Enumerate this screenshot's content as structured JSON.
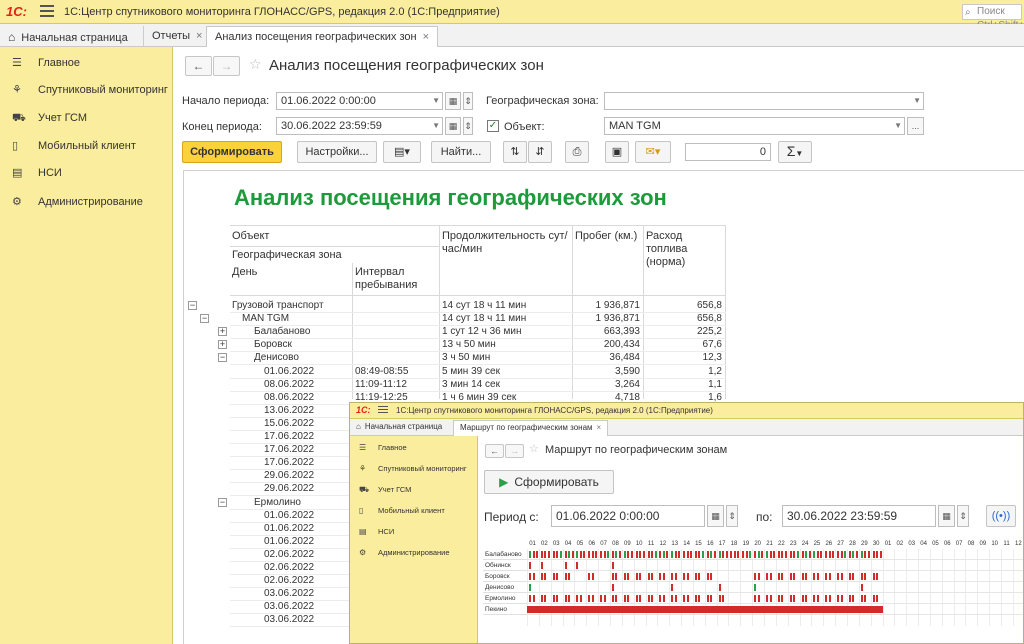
{
  "app": {
    "logo": "1С:",
    "title": "1С:Центр спутникового мониторинга ГЛОНАСС/GPS, редакция 2.0  (1С:Предприятие)",
    "search_placeholder": "Поиск Ctrl+Shift+F"
  },
  "tabs": [
    {
      "label": "Начальная страница",
      "icon": "home-icon"
    },
    {
      "label": "Отчеты"
    },
    {
      "label": "Анализ посещения географических зон",
      "active": true
    }
  ],
  "sidebar": {
    "items": [
      {
        "label": "Главное",
        "icon": "menu-lines-icon"
      },
      {
        "label": "Спутниковый мониторинг",
        "icon": "satellite-icon"
      },
      {
        "label": "Учет ГСМ",
        "icon": "truck-icon"
      },
      {
        "label": "Мобильный клиент",
        "icon": "phone-icon"
      },
      {
        "label": "НСИ",
        "icon": "books-icon"
      },
      {
        "label": "Администрирование",
        "icon": "gear-icon"
      }
    ]
  },
  "form": {
    "title": "Анализ посещения географических зон",
    "period_start_label": "Начало периода:",
    "period_start_value": "01.06.2022  0:00:00",
    "period_end_label": "Конец периода:",
    "period_end_value": "30.06.2022 23:59:59",
    "zone_label": "Географическая зона:",
    "zone_value": "",
    "object_label": "Объект:",
    "object_checked": true,
    "object_value": "MAN TGM",
    "object_more": "...",
    "buttons": {
      "generate": "Сформировать",
      "settings": "Настройки...",
      "find": "Найти...",
      "sum_value": "0",
      "sigma": "Σ"
    }
  },
  "report": {
    "title": "Анализ посещения географических зон",
    "headers": {
      "object": "Объект",
      "zone": "Географическая зона",
      "day": "День",
      "interval": "Интервал пребывания",
      "duration": "Продолжительность сут/час/мин",
      "mileage": "Пробег (км.)",
      "fuel": "Расход топлива (норма)"
    },
    "rows": [
      {
        "name": "Грузовой транспорт",
        "level": 0,
        "toggle": "−",
        "interval": "",
        "duration": "14 сут 18 ч 11 мин",
        "mileage": "1 936,871",
        "fuel": "656,8"
      },
      {
        "name": "MAN TGM",
        "level": 1,
        "toggle": "−",
        "interval": "",
        "duration": "14 сут 18 ч 11 мин",
        "mileage": "1 936,871",
        "fuel": "656,8"
      },
      {
        "name": "Балабаново",
        "level": 2,
        "toggle": "+",
        "interval": "",
        "duration": "1 сут 12 ч 36 мин",
        "mileage": "663,393",
        "fuel": "225,2"
      },
      {
        "name": "Боровск",
        "level": 2,
        "toggle": "+",
        "interval": "",
        "duration": "13 ч 50 мин",
        "mileage": "200,434",
        "fuel": "67,6"
      },
      {
        "name": "Денисово",
        "level": 2,
        "toggle": "−",
        "interval": "",
        "duration": "3 ч 50 мин",
        "mileage": "36,484",
        "fuel": "12,3"
      },
      {
        "name": "01.06.2022",
        "level": 3,
        "interval": "08:49-08:55",
        "duration": "5 мин 39 сек",
        "mileage": "3,590",
        "fuel": "1,2"
      },
      {
        "name": "08.06.2022",
        "level": 3,
        "interval": "11:09-11:12",
        "duration": "3 мин 14 сек",
        "mileage": "3,264",
        "fuel": "1,1"
      },
      {
        "name": "08.06.2022",
        "level": 3,
        "interval": "11:19-12:25",
        "duration": "1 ч 6 мин 39 сек",
        "mileage": "4,718",
        "fuel": "1,6"
      },
      {
        "name": "13.06.2022",
        "level": 3
      },
      {
        "name": "15.06.2022",
        "level": 3
      },
      {
        "name": "17.06.2022",
        "level": 3
      },
      {
        "name": "17.06.2022",
        "level": 3
      },
      {
        "name": "17.06.2022",
        "level": 3
      },
      {
        "name": "29.06.2022",
        "level": 3
      },
      {
        "name": "29.06.2022",
        "level": 3
      },
      {
        "name": "Ермолино",
        "level": 2,
        "toggle": "−"
      },
      {
        "name": "01.06.2022",
        "level": 3
      },
      {
        "name": "01.06.2022",
        "level": 3
      },
      {
        "name": "01.06.2022",
        "level": 3
      },
      {
        "name": "02.06.2022",
        "level": 3
      },
      {
        "name": "02.06.2022",
        "level": 3
      },
      {
        "name": "02.06.2022",
        "level": 3
      },
      {
        "name": "03.06.2022",
        "level": 3
      },
      {
        "name": "03.06.2022",
        "level": 3
      },
      {
        "name": "03.06.2022",
        "level": 3
      }
    ]
  },
  "overlay": {
    "logo": "1С:",
    "title": "1С:Центр спутникового мониторинга ГЛОНАСС/GPS, редакция 2.0  (1С:Предприятие)",
    "tabs": [
      {
        "label": "Начальная страница"
      },
      {
        "label": "Маршрут по географическим зонам",
        "active": true
      }
    ],
    "sidebar": [
      "Главное",
      "Спутниковый мониторинг",
      "Учет ГСМ",
      "Мобильный клиент",
      "НСИ",
      "Администрирование"
    ],
    "form_title": "Маршрут по географическим зонам",
    "generate": "Сформировать",
    "period_label": "Период с:",
    "period_from": "01.06.2022  0:00:00",
    "to_label": "по:",
    "period_to": "30.06.2022 23:59:59",
    "days": [
      "01",
      "02",
      "03",
      "04",
      "05",
      "06",
      "07",
      "08",
      "09",
      "10",
      "11",
      "12",
      "13",
      "14",
      "15",
      "16",
      "17",
      "18",
      "19",
      "20",
      "21",
      "22",
      "23",
      "24",
      "25",
      "26",
      "27",
      "28",
      "29",
      "30",
      "01",
      "02",
      "03",
      "04",
      "05",
      "06",
      "07",
      "08",
      "09",
      "10",
      "11",
      "12"
    ],
    "zones": [
      "Балабаново",
      "Обнинск",
      "Боровск",
      "Денисово",
      "Ермолино",
      "Пекино"
    ]
  }
}
